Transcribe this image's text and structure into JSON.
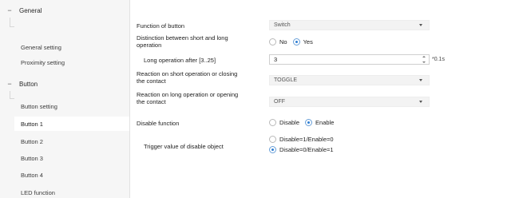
{
  "tree": {
    "groups": [
      {
        "label": "General",
        "toggle": "−"
      },
      {
        "label": "Button",
        "toggle": "−"
      }
    ],
    "general_items": [
      "General setting",
      "Proximity setting"
    ],
    "button_items": [
      "Button setting",
      "Button 1",
      "Button 2",
      "Button 3",
      "Button 4",
      "LED function"
    ],
    "active_item": "Button 1"
  },
  "params": {
    "function_of_button": {
      "label": "Function of button",
      "value": "Switch"
    },
    "distinction": {
      "label_line1": "Distinction between short and long",
      "label_line2": "operation",
      "options": [
        "No",
        "Yes"
      ],
      "selected": "Yes"
    },
    "long_operation": {
      "label": "Long operation after [3..25]",
      "value": "3",
      "unit": "*0.1s"
    },
    "short_reaction": {
      "label_line1": "Reaction on short operation or closing",
      "label_line2": "the contact",
      "value": "TOGGLE"
    },
    "long_reaction": {
      "label_line1": "Reaction on long operation or opening",
      "label_line2": "the contact",
      "value": "OFF"
    },
    "disable_function": {
      "label": "Disable function",
      "options": [
        "Disable",
        "Enable"
      ],
      "selected": "Enable"
    },
    "trigger_value": {
      "label": "Trigger value of disable object",
      "options": [
        "Disable=1/Enable=0",
        "Disable=0/Enable=1"
      ],
      "selected": "Disable=0/Enable=1"
    }
  },
  "colors": {
    "accent": "#2f7fd3",
    "tree_bg": "#f6f6f6",
    "combo_bg": "#f3f3f3"
  }
}
